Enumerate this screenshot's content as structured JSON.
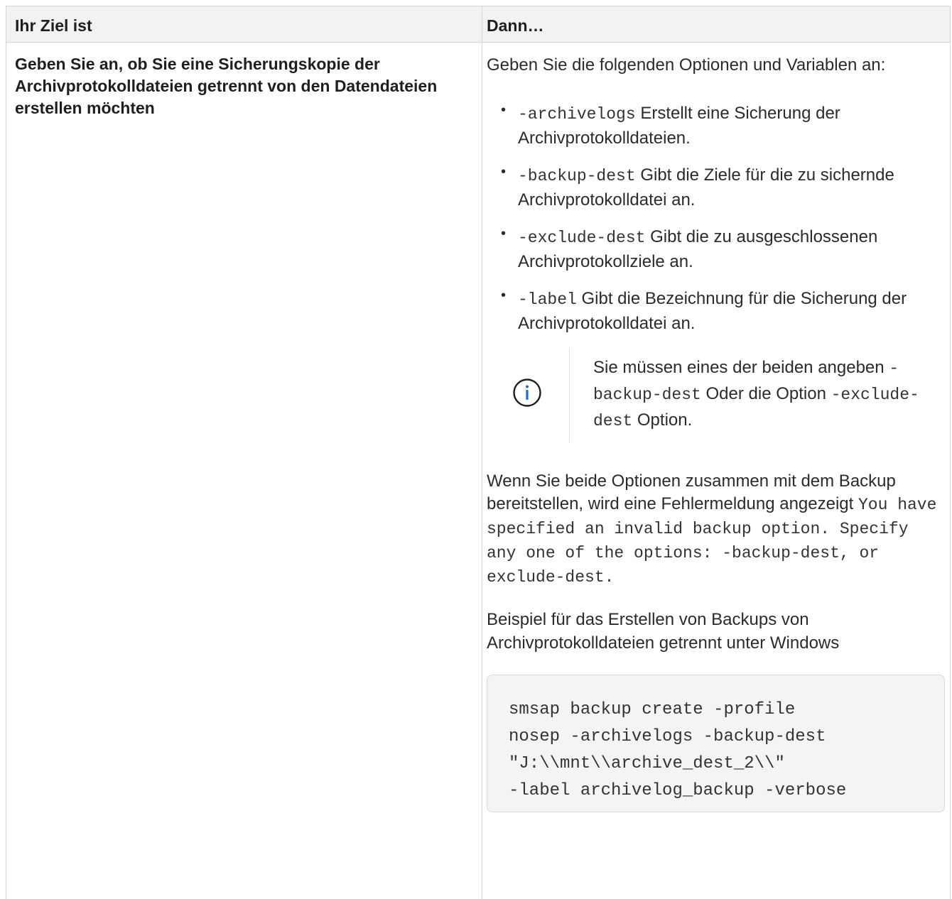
{
  "table": {
    "headers": [
      "Ihr Ziel ist",
      "Dann…"
    ],
    "goal": "Geben Sie an, ob Sie eine Sicherungskopie der Archivprotokolldateien getrennt von den Datendateien erstellen möchten",
    "intro": "Geben Sie die folgenden Optionen und Variablen an:",
    "options": [
      {
        "code": "-archivelogs",
        "text": "Erstellt eine Sicherung der Archivprotokolldateien."
      },
      {
        "code": "-backup-dest",
        "text": "Gibt die Ziele für die zu sichernde Archivprotokolldatei an."
      },
      {
        "code": "-exclude-dest",
        "text": "Gibt die zu ausgeschlossenen Archivprotokollziele an."
      },
      {
        "code": "-label",
        "text": "Gibt die Bezeichnung für die Sicherung der Archivprotokolldatei an."
      }
    ],
    "note": {
      "icon": "info-circle-icon",
      "part1": "Sie müssen eines der beiden angeben",
      "code1": "-backup-dest",
      "part2": "Oder die Option",
      "code2": "-exclude-dest",
      "part3": "Option."
    },
    "error_para": {
      "text": "Wenn Sie beide Optionen zusammen mit dem Backup bereitstellen, wird eine Fehlermeldung angezeigt",
      "code": "You have specified an invalid backup option. Specify any one of the options: -backup-dest, or exclude-dest."
    },
    "example_intro": "Beispiel für das Erstellen von Backups von Archivprotokolldateien getrennt unter Windows",
    "code_lines": [
      "smsap backup create -profile",
      "nosep -archivelogs -backup-dest",
      "\"J:\\\\mnt\\\\archive_dest_2\\\\\"",
      "-label archivelog_backup -verbose"
    ]
  },
  "colors": {
    "header_bg": "#f2f2f2",
    "border": "#d5d5d5",
    "info_icon": "#1e6fc7",
    "code_bg": "#f4f4f4"
  }
}
